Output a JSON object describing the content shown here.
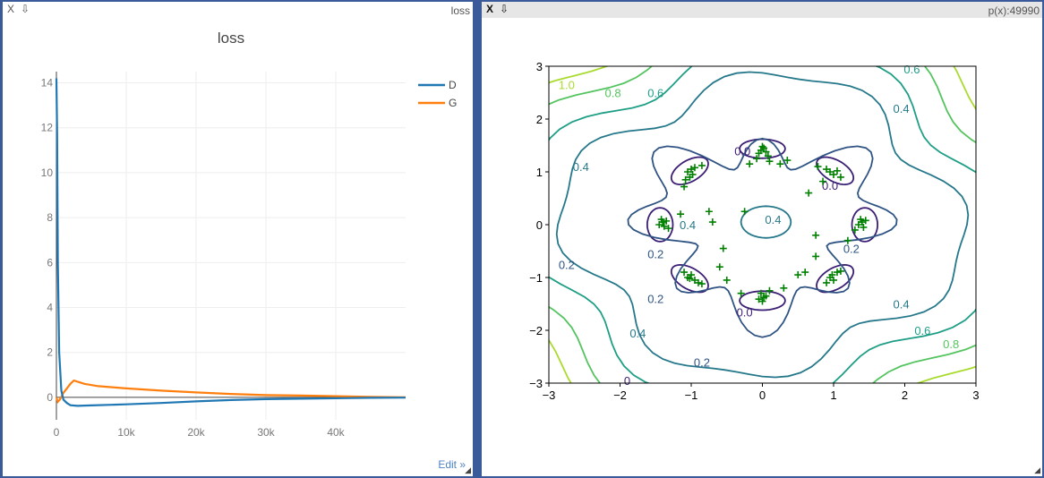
{
  "left_window": {
    "close_label": "X",
    "pin_label": "⇩",
    "title": "loss",
    "edit_label": "Edit »"
  },
  "right_window": {
    "close_label": "X",
    "pin_label": "⇩",
    "title": "p(x):49990"
  },
  "colors": {
    "D": "#1f77b4",
    "G": "#ff7f0e",
    "samples": "#008000",
    "contour_levels": {
      "0.0": "#3b1f74",
      "0.2": "#2f5484",
      "0.4": "#25788a",
      "0.6": "#1f9e86",
      "0.8": "#54c45f",
      "1.0": "#a9db2f"
    }
  },
  "chart_data": [
    {
      "type": "line",
      "title": "loss",
      "xlabel": "",
      "ylabel": "",
      "xlim": [
        0,
        50000
      ],
      "ylim": [
        -1,
        14.5
      ],
      "x_ticks": [
        0,
        10000,
        20000,
        30000,
        40000
      ],
      "x_tick_labels": [
        "0",
        "10k",
        "20k",
        "30k",
        "40k"
      ],
      "y_ticks": [
        0,
        2,
        4,
        6,
        8,
        10,
        12,
        14
      ],
      "y_tick_labels": [
        "0",
        "2",
        "4",
        "6",
        "8",
        "10",
        "12",
        "14"
      ],
      "grid": true,
      "legend": "top-right",
      "series": [
        {
          "name": "D",
          "x": [
            0,
            100,
            200,
            400,
            700,
            1000,
            1500,
            2000,
            3000,
            5000,
            8000,
            10000,
            15000,
            20000,
            25000,
            30000,
            35000,
            40000,
            45000,
            50000
          ],
          "y": [
            14.2,
            11.7,
            6.0,
            2.0,
            0.3,
            -0.1,
            -0.25,
            -0.35,
            -0.38,
            -0.36,
            -0.33,
            -0.31,
            -0.25,
            -0.18,
            -0.12,
            -0.08,
            -0.06,
            -0.04,
            -0.02,
            -0.01
          ]
        },
        {
          "name": "G",
          "x": [
            0,
            200,
            500,
            1000,
            1500,
            2000,
            2500,
            3000,
            4000,
            6000,
            8000,
            10000,
            15000,
            20000,
            25000,
            30000,
            35000,
            40000,
            45000,
            50000
          ],
          "y": [
            0.0,
            -0.2,
            -0.1,
            0.2,
            0.4,
            0.6,
            0.75,
            0.7,
            0.6,
            0.5,
            0.45,
            0.4,
            0.3,
            0.22,
            0.15,
            0.1,
            0.08,
            0.05,
            0.02,
            0.0
          ]
        }
      ]
    },
    {
      "type": "scatter",
      "title": "",
      "xlabel": "",
      "ylabel": "",
      "xlim": [
        -3,
        3
      ],
      "ylim": [
        -3,
        3
      ],
      "x_ticks": [
        -3,
        -2,
        -1,
        0,
        1,
        2,
        3
      ],
      "x_tick_labels": [
        "−3",
        "−2",
        "−1",
        "0",
        "1",
        "2",
        "3"
      ],
      "y_ticks": [
        -3,
        -2,
        -1,
        0,
        1,
        2,
        3
      ],
      "y_tick_labels": [
        "−3",
        "−2",
        "−1",
        "0",
        "1",
        "2",
        "3"
      ],
      "grid": false,
      "contour_levels": [
        0.0,
        0.2,
        0.4,
        0.6,
        0.8,
        1.0
      ],
      "contour_labels": [
        {
          "text": "1.0",
          "x": -2.75,
          "y": 2.65
        },
        {
          "text": "0.8",
          "x": -2.1,
          "y": 2.5
        },
        {
          "text": "0.6",
          "x": -1.5,
          "y": 2.5
        },
        {
          "text": "0.4",
          "x": -2.55,
          "y": 1.1
        },
        {
          "text": "0.0",
          "x": -0.28,
          "y": 1.4
        },
        {
          "text": "0.0",
          "x": 0.95,
          "y": 0.75
        },
        {
          "text": "0.6",
          "x": 2.1,
          "y": 2.95
        },
        {
          "text": "0.4",
          "x": 1.95,
          "y": 2.2
        },
        {
          "text": "0.4",
          "x": 0.15,
          "y": 0.1
        },
        {
          "text": "0.4",
          "x": -1.05,
          "y": 0
        },
        {
          "text": "0.2",
          "x": -1.5,
          "y": -0.55
        },
        {
          "text": "0.2",
          "x": 1.25,
          "y": -0.45
        },
        {
          "text": "0.2",
          "x": -2.75,
          "y": -0.75
        },
        {
          "text": "0.2",
          "x": -1.5,
          "y": -1.4
        },
        {
          "text": "0.0",
          "x": -0.25,
          "y": -1.65
        },
        {
          "text": "0.2",
          "x": -0.85,
          "y": -2.6
        },
        {
          "text": "0.4",
          "x": -1.75,
          "y": -2.05
        },
        {
          "text": "0.4",
          "x": 1.95,
          "y": -1.5
        },
        {
          "text": "0.6",
          "x": 2.25,
          "y": -2.0
        },
        {
          "text": "0.8",
          "x": 2.65,
          "y": -2.25
        },
        {
          "text": "0",
          "x": -1.9,
          "y": -2.95
        }
      ],
      "mode_centers": [
        [
          -1.0,
          1.0
        ],
        [
          0.0,
          1.41
        ],
        [
          1.0,
          1.0
        ],
        [
          -1.41,
          0.0
        ],
        [
          1.41,
          0.0
        ],
        [
          -1.0,
          -1.0
        ],
        [
          0.0,
          -1.41
        ],
        [
          1.0,
          -1.0
        ]
      ],
      "series": [
        {
          "name": "",
          "x": [
            -1.05,
            -1.0,
            -0.98,
            -1.02,
            -0.95,
            -1.08,
            -0.85,
            -1.1,
            -0.02,
            0.02,
            0.05,
            -0.05,
            0.0,
            0.08,
            -0.08,
            0.1,
            0.95,
            1.0,
            1.05,
            0.9,
            1.1,
            0.85,
            0.78,
            -1.45,
            -1.4,
            -1.38,
            -1.42,
            -1.35,
            -1.32,
            1.35,
            1.4,
            1.42,
            1.45,
            1.38,
            1.3,
            -1.05,
            -1.0,
            -0.95,
            -1.02,
            -1.1,
            -0.9,
            -0.85,
            -0.05,
            0.0,
            0.02,
            0.05,
            -0.02,
            0.1,
            0.95,
            1.0,
            0.98,
            1.05,
            0.9,
            1.1,
            -0.6,
            -0.3,
            0.3,
            0.6,
            -0.5,
            0.5,
            -0.75,
            0.75,
            -0.25,
            0.25,
            -0.18,
            0.35,
            -0.55,
            0.65,
            -1.15,
            1.2,
            -0.7,
            0.75
          ],
          "y": [
            1.0,
            1.05,
            0.95,
            0.9,
            1.08,
            0.85,
            1.12,
            0.72,
            1.41,
            1.45,
            1.38,
            1.35,
            1.48,
            1.3,
            1.25,
            1.2,
            1.0,
            0.95,
            1.02,
            1.05,
            0.9,
            0.82,
            1.1,
            0.0,
            0.05,
            -0.03,
            0.1,
            0.07,
            -0.07,
            0.0,
            0.05,
            -0.05,
            0.08,
            0.1,
            -0.1,
            -1.0,
            -0.95,
            -1.05,
            -1.02,
            -0.9,
            -1.1,
            -1.12,
            -1.41,
            -1.45,
            -1.38,
            -1.35,
            -1.3,
            -1.25,
            -1.0,
            -1.05,
            -0.95,
            -0.9,
            -1.1,
            -0.88,
            -0.8,
            -1.3,
            -1.2,
            -0.9,
            -1.05,
            -0.95,
            0.25,
            -0.6,
            0.25,
            1.15,
            1.15,
            1.22,
            -0.45,
            0.6,
            0.2,
            -0.3,
            0.05,
            -0.2
          ]
        }
      ]
    }
  ]
}
